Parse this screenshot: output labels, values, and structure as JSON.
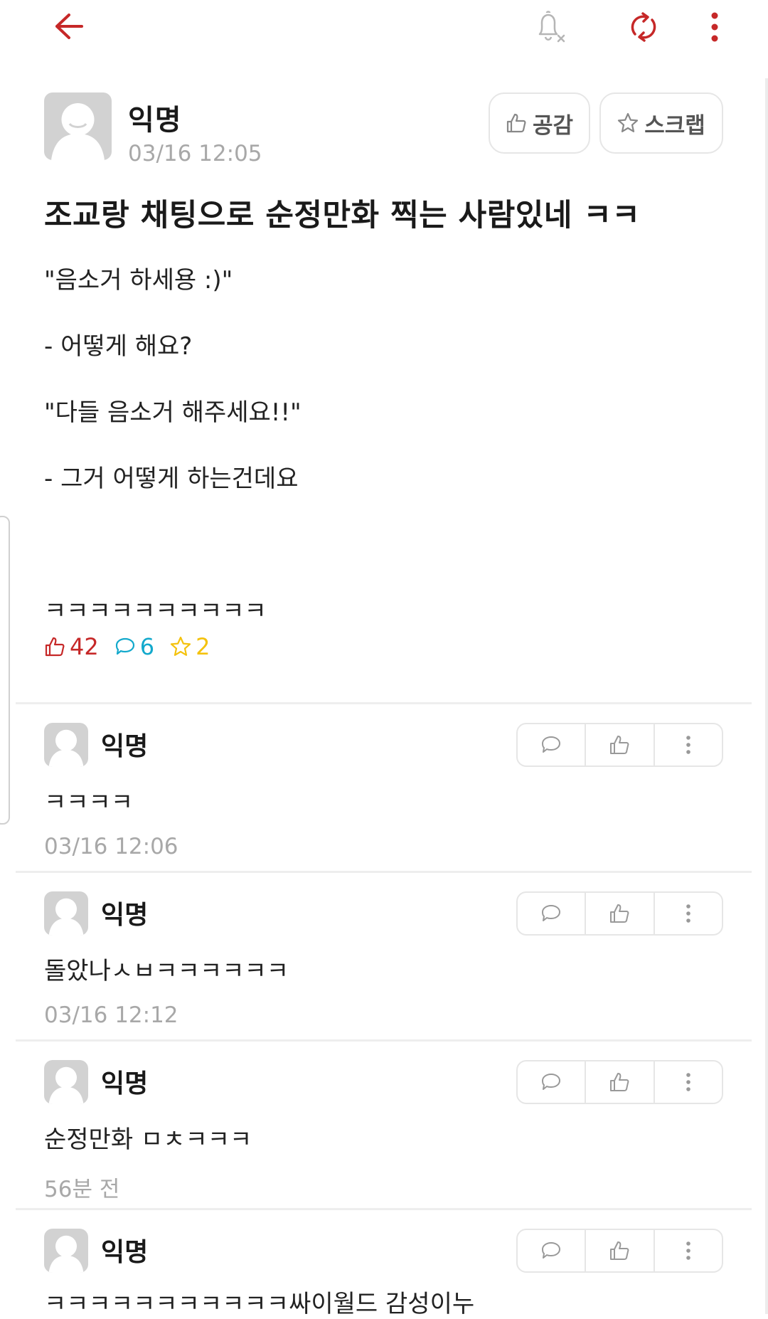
{
  "topbar": {
    "back_icon": "arrow-left-icon",
    "bell_icon": "bell-off-icon",
    "refresh_icon": "refresh-icon",
    "more_icon": "kebab-menu-icon",
    "accent_color": "#c62828"
  },
  "post": {
    "author": "익명",
    "date": "03/16 12:05",
    "like_label": "공감",
    "scrap_label": "스크랩",
    "title": "조교랑 채팅으로 순정만화 찍는 사람있네 ㅋㅋ",
    "body_lines": [
      "\"음소거 하세용 :)\"",
      "",
      "- 어떻게 해요?",
      "",
      "\"다들 음소거 해주세요!!\"",
      "",
      "- 그거 어떻게 하는건데요",
      "",
      "",
      "",
      "",
      "ㅋㅋㅋㅋㅋㅋㅋㅋㅋㅋ"
    ],
    "stats": {
      "likes": "42",
      "comments": "6",
      "scraps": "2",
      "like_color": "#c62828",
      "comment_color": "#13a9cc",
      "scrap_color": "#f4c20d"
    }
  },
  "comments": [
    {
      "author": "익명",
      "text": "ㅋㅋㅋㅋ",
      "time": "03/16 12:06"
    },
    {
      "author": "익명",
      "text": "돌았나ㅅㅂㅋㅋㅋㅋㅋㅋ",
      "time": "03/16 12:12"
    },
    {
      "author": "익명",
      "text": "순정만화 ㅁㅊㅋㅋㅋ",
      "time": "56분 전"
    },
    {
      "author": "익명",
      "text": "ㅋㅋㅋㅋㅋㅋㅋㅋㅋㅋㅋ싸이월드 감성이누",
      "time": ""
    }
  ]
}
